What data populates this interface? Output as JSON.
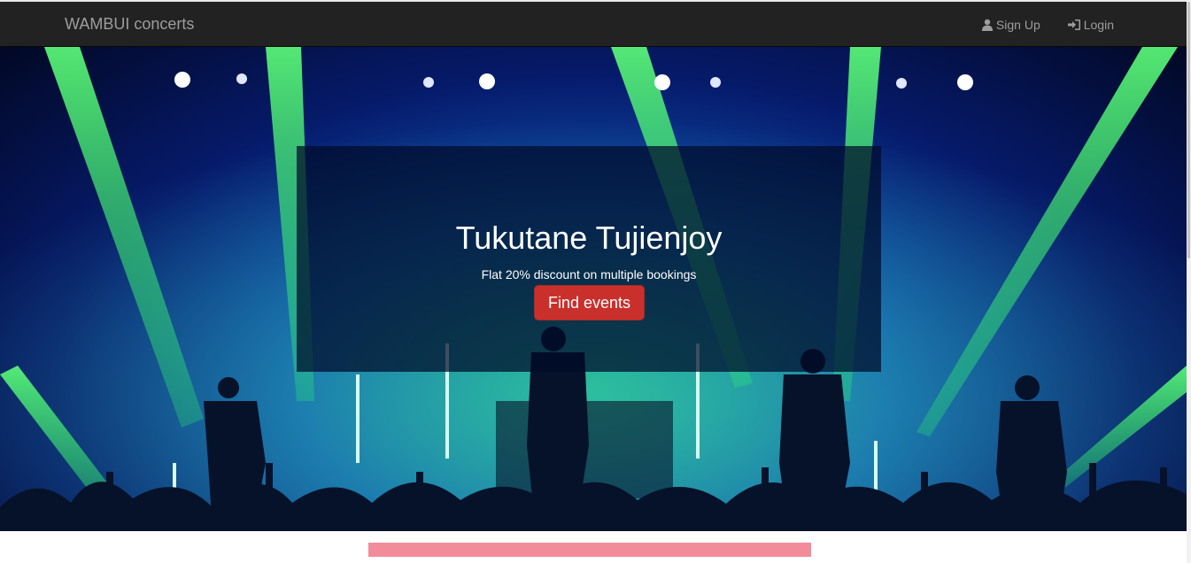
{
  "navbar": {
    "brand": "WAMBUI concerts",
    "links": [
      {
        "label": "Sign Up",
        "icon": "user-icon"
      },
      {
        "label": "Login",
        "icon": "login-icon"
      }
    ]
  },
  "hero": {
    "title": "Tukutane Tujienjoy",
    "subtitle": "Flat 20% discount on multiple bookings",
    "cta_label": "Find events",
    "cta_color": "#c9302c"
  },
  "colors": {
    "navbar_bg": "#222222",
    "nav_text": "#9d9d9d",
    "accent_bar": "#f28b9a"
  }
}
